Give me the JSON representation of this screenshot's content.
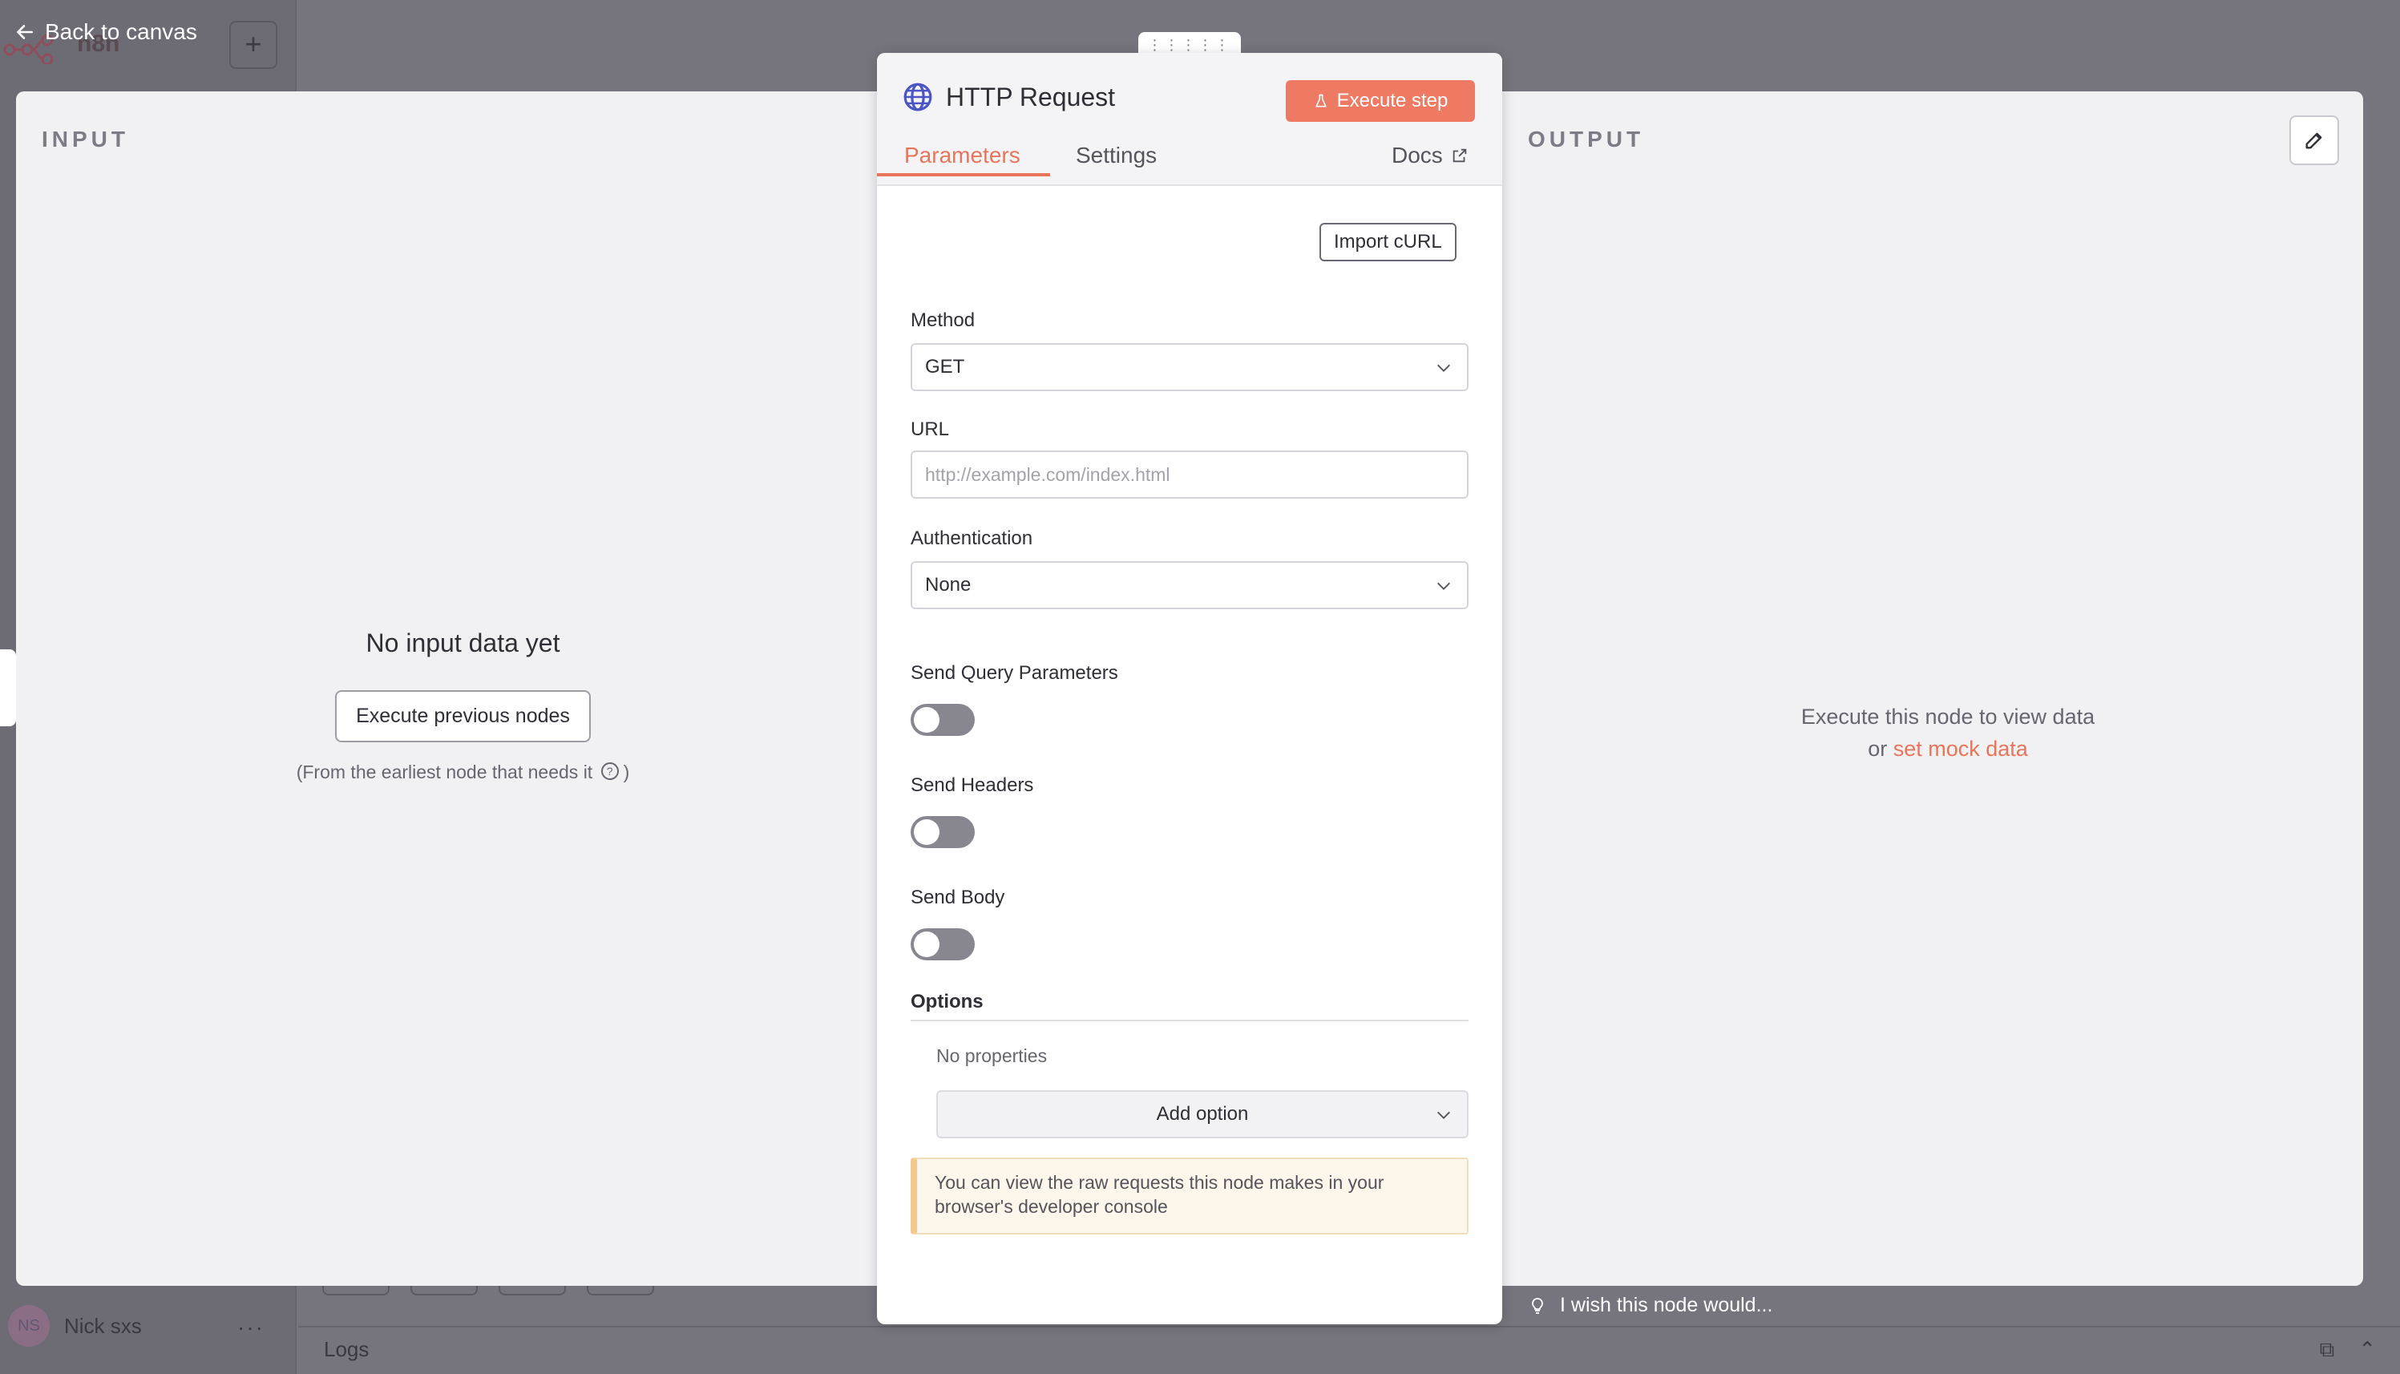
{
  "background": {
    "app_name": "n8n",
    "user_initials": "NS",
    "user_name": "Nick sxs",
    "logs_label": "Logs",
    "plus_label": "+",
    "more_label": "···"
  },
  "back_label": "Back to canvas",
  "input_panel": {
    "label": "INPUT",
    "empty_title": "No input data yet",
    "execute_previous_label": "Execute previous nodes",
    "hint_prefix": "(From the earliest node that needs it",
    "hint_suffix": ")"
  },
  "output_panel": {
    "label": "OUTPUT",
    "empty_line1": "Execute this node to view data",
    "empty_or": "or",
    "mock_link": "set mock data"
  },
  "node": {
    "title": "HTTP Request",
    "execute_step_label": "Execute step",
    "tabs": [
      "Parameters",
      "Settings"
    ],
    "docs_label": "Docs",
    "import_curl_label": "Import cURL",
    "method": {
      "label": "Method",
      "value": "GET"
    },
    "url": {
      "label": "URL",
      "placeholder": "http://example.com/index.html"
    },
    "authentication": {
      "label": "Authentication",
      "value": "None"
    },
    "toggles": [
      {
        "label": "Send Query Parameters",
        "on": false
      },
      {
        "label": "Send Headers",
        "on": false
      },
      {
        "label": "Send Body",
        "on": false
      }
    ],
    "options": {
      "title": "Options",
      "empty": "No properties",
      "add_label": "Add option"
    },
    "notice": "You can view the raw requests this node makes in your browser's developer console"
  },
  "feedback_label": "I wish this node would...",
  "colors": {
    "accent": "#e8755a",
    "execute_button": "#ef7a63",
    "overlay": "#76747d"
  }
}
